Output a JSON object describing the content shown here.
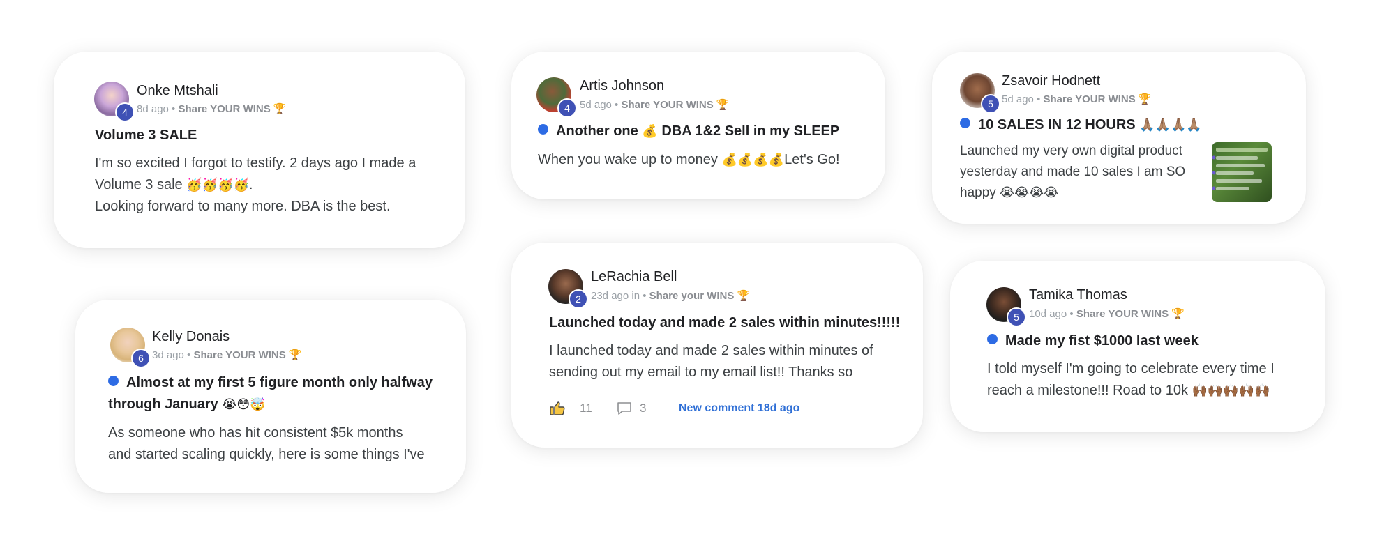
{
  "cards": [
    {
      "author": "Onke Mtshali",
      "level": "4",
      "time": "8d ago",
      "sep": " • ",
      "category": "Share YOUR WINS",
      "trophy": "🏆",
      "title": "Volume 3 SALE",
      "body_lines": [
        "I'm so excited I forgot to testify. 2 days ago I made a",
        "Volume 3 sale ",
        ".",
        "Looking forward to many more. DBA is the best."
      ],
      "emoji": "🥳🥳🥳🥳"
    },
    {
      "author": "Artis Johnson",
      "level": "4",
      "time": "5d ago",
      "sep": " • ",
      "category": "Share YOUR WINS",
      "trophy": "🏆",
      "title_pre": "Another one ",
      "title_emoji": "💰",
      "title_post": " DBA 1&2 Sell in my SLEEP",
      "body_pre": "When you wake up to money ",
      "body_emoji": "💰💰💰💰",
      "body_post": "Let's Go!"
    },
    {
      "author": "Zsavoir Hodnett",
      "level": "5",
      "time": "5d ago",
      "sep": " • ",
      "category": "Share YOUR WINS",
      "trophy": "🏆",
      "title": "10 SALES IN 12 HOURS ",
      "title_emoji": "🙏🏽🙏🏽🙏🏽🙏🏽",
      "body_lines": [
        "Launched my very own digital product",
        "yesterday and made 10 sales I am SO",
        "happy "
      ],
      "body_emoji": "😭😭😭😭"
    },
    {
      "author": "Kelly Donais",
      "level": "6",
      "time": "3d ago",
      "sep": " • ",
      "category": "Share YOUR WINS",
      "trophy": "🏆",
      "title_line1": "Almost at my first 5 figure month only halfway",
      "title_line2": "through January ",
      "title_emoji": "😭😳🤯",
      "body_lines": [
        "As someone who has hit consistent $5k months",
        "and started scaling quickly, here is some things I've"
      ]
    },
    {
      "author": "LeRachia Bell",
      "level": "2",
      "time": "23d ago in",
      "sep": " • ",
      "category": "Share your WINS",
      "trophy": "🏆",
      "title": "Launched today and made 2 sales within minutes!!!!!",
      "body_lines": [
        "I launched today and made 2 sales within minutes of",
        "sending out my email to my email list!! Thanks so"
      ],
      "likes": "11",
      "comments": "3",
      "new_comment": "New comment 18d ago"
    },
    {
      "author": "Tamika Thomas",
      "level": "5",
      "time": "10d ago",
      "sep": " • ",
      "category": "Share YOUR WINS",
      "trophy": "🏆",
      "title": "Made my fist $1000 last week",
      "body_lines": [
        "I told myself I'm going to celebrate every time I",
        "reach a milestone!!! Road to 10k "
      ],
      "body_emoji": "🙌🏾🙌🏾🙌🏾🙌🏾🙌🏾"
    }
  ],
  "colors": {
    "badge": "#3f51b5",
    "unread_dot": "#2d6be4",
    "link": "#2f6fd6"
  }
}
